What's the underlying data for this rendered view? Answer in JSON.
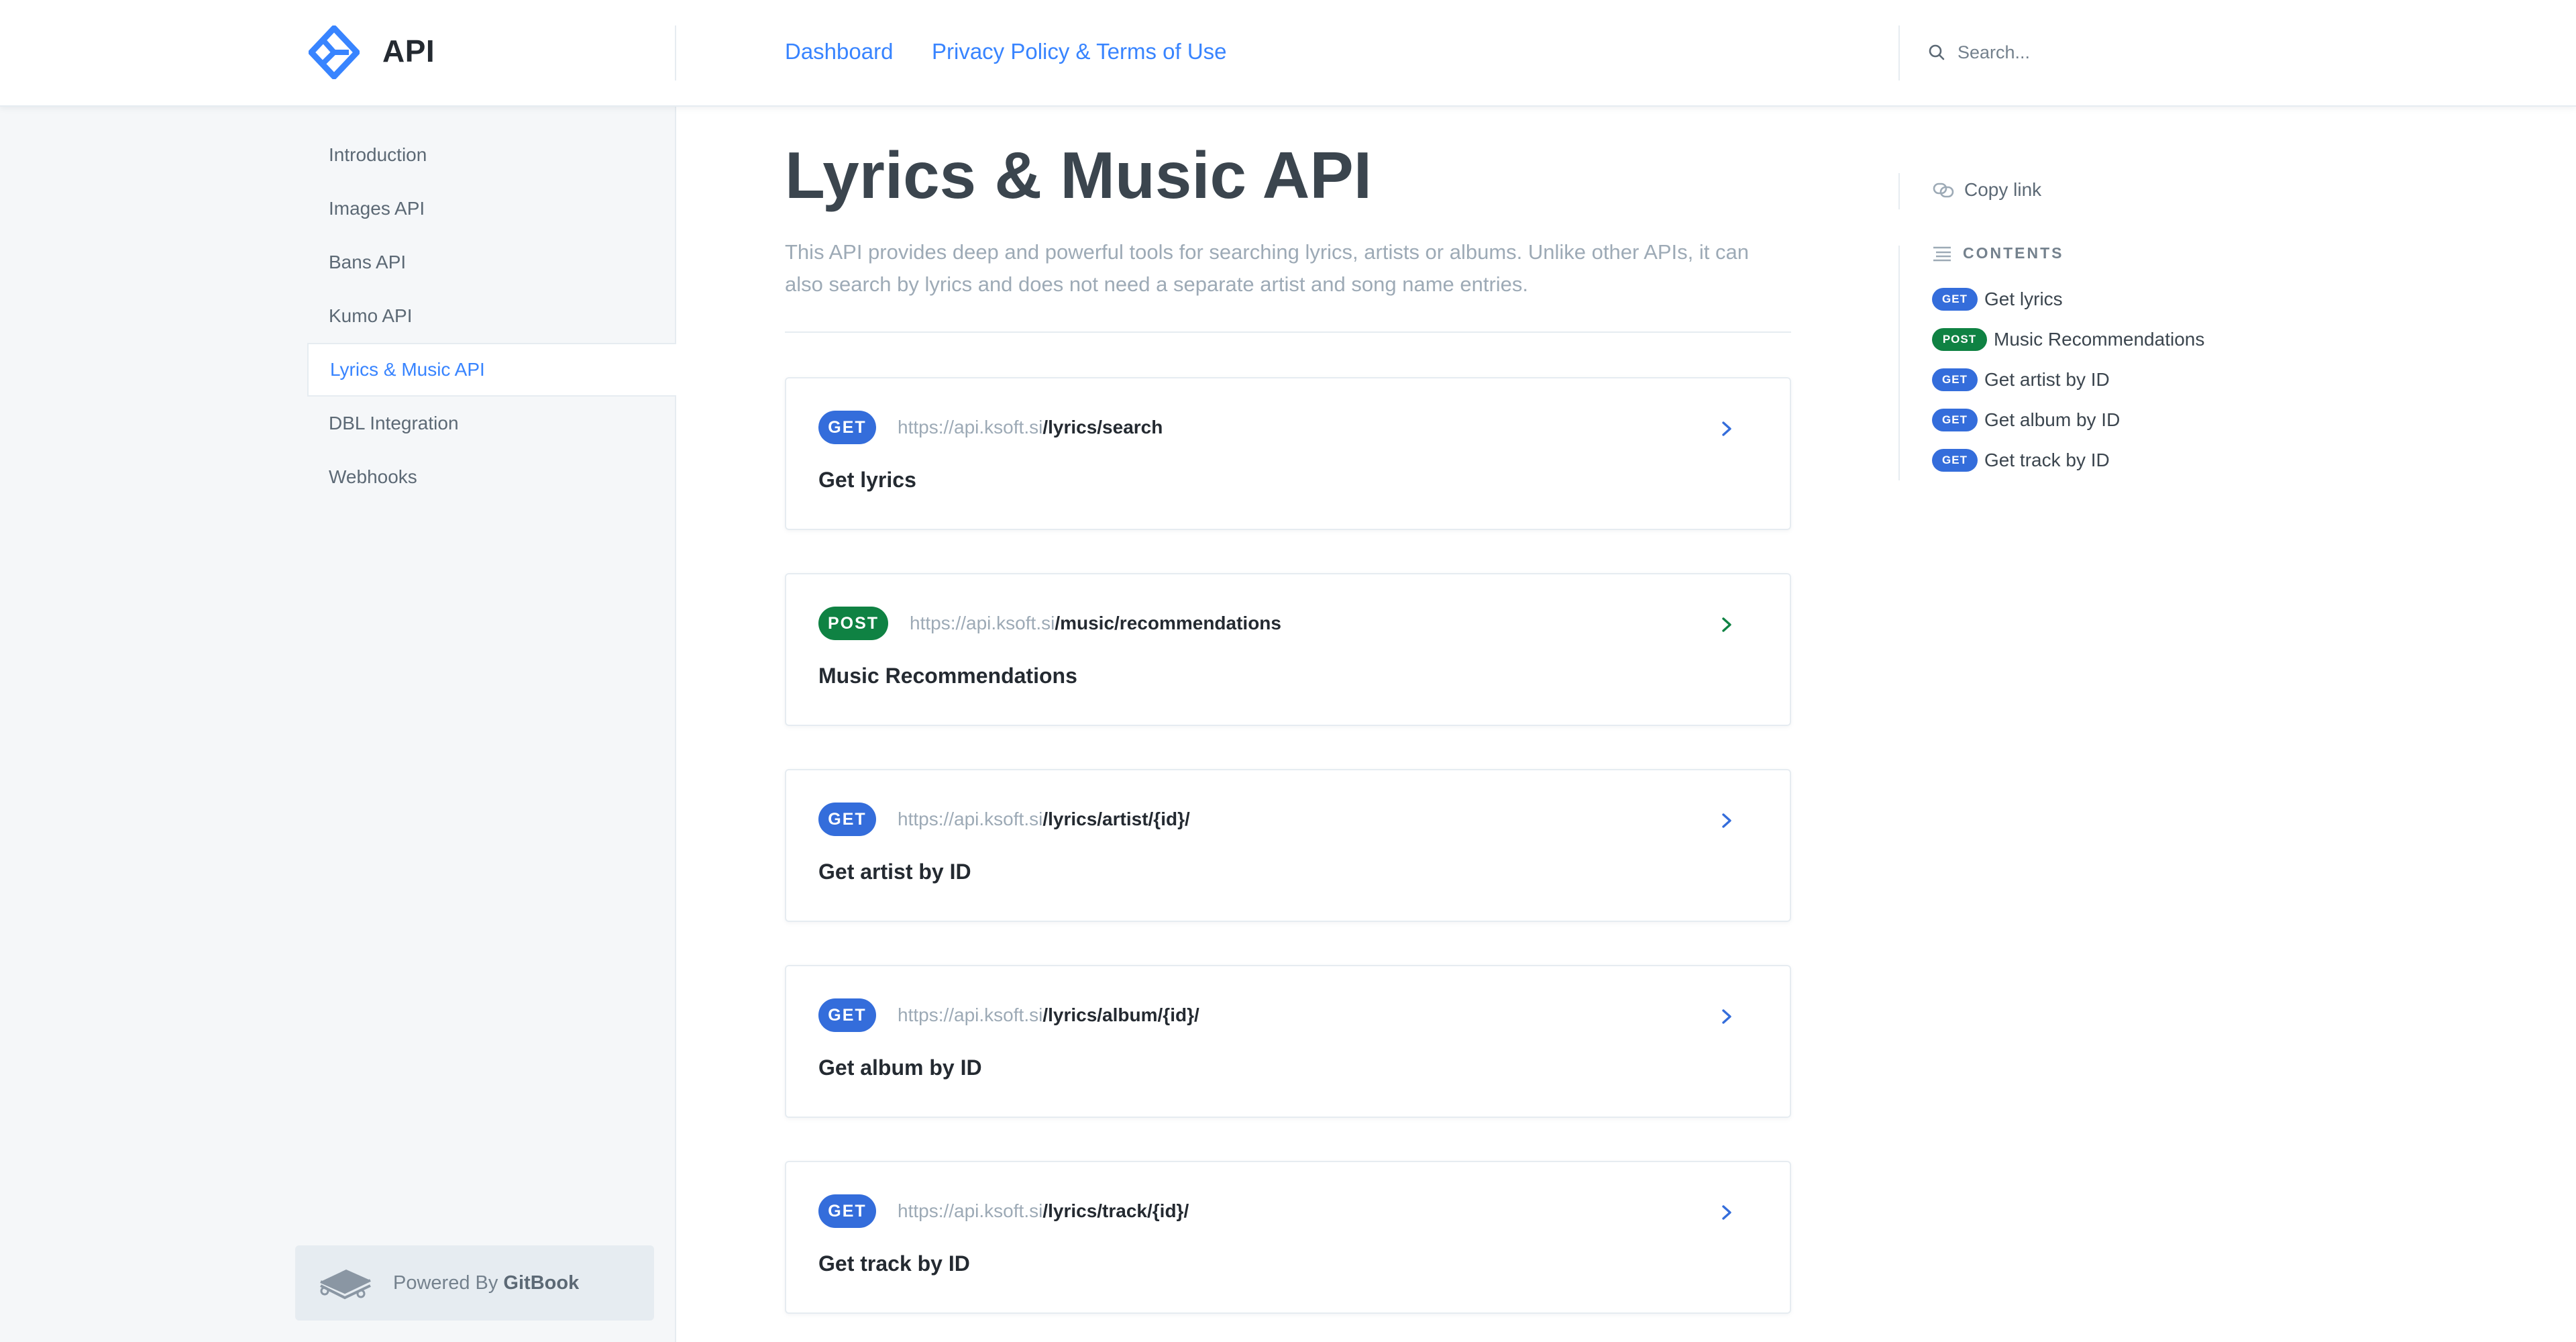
{
  "header": {
    "site_title": "API",
    "nav": [
      "Dashboard",
      "Privacy Policy & Terms of Use"
    ],
    "search_placeholder": "Search..."
  },
  "sidebar": {
    "items": [
      {
        "label": "Introduction",
        "active": false
      },
      {
        "label": "Images API",
        "active": false
      },
      {
        "label": "Bans API",
        "active": false
      },
      {
        "label": "Kumo API",
        "active": false
      },
      {
        "label": "Lyrics & Music API",
        "active": true
      },
      {
        "label": "DBL Integration",
        "active": false
      },
      {
        "label": "Webhooks",
        "active": false
      }
    ],
    "powered_prefix": "Powered By",
    "powered_brand": "GitBook"
  },
  "page": {
    "title": "Lyrics & Music API",
    "description": "This API provides deep and powerful tools for searching lyrics, artists or albums. Unlike other APIs, it can also search by lyrics and does not need a separate artist and song name entries."
  },
  "endpoints": [
    {
      "method": "GET",
      "base": "https://api.ksoft.si",
      "path": "/lyrics/search",
      "title": "Get lyrics"
    },
    {
      "method": "POST",
      "base": "https://api.ksoft.si",
      "path": "/music/recommendations",
      "title": "Music Recommendations"
    },
    {
      "method": "GET",
      "base": "https://api.ksoft.si",
      "path": "/lyrics/artist/{id}/",
      "title": "Get artist by ID"
    },
    {
      "method": "GET",
      "base": "https://api.ksoft.si",
      "path": "/lyrics/album/{id}/",
      "title": "Get album by ID"
    },
    {
      "method": "GET",
      "base": "https://api.ksoft.si",
      "path": "/lyrics/track/{id}/",
      "title": "Get track by ID"
    }
  ],
  "toc": {
    "copy_link": "Copy link",
    "contents_label": "CONTENTS",
    "items": [
      {
        "method": "GET",
        "label": "Get lyrics"
      },
      {
        "method": "POST",
        "label": "Music Recommendations"
      },
      {
        "method": "GET",
        "label": "Get artist by ID"
      },
      {
        "method": "GET",
        "label": "Get album by ID"
      },
      {
        "method": "GET",
        "label": "Get track by ID"
      }
    ]
  },
  "colors": {
    "accent": "#3884ff",
    "get_badge": "#346ddb",
    "post_badge": "#0f8243",
    "sidebar_bg": "#f5f7f9",
    "border": "#e6ecf1"
  },
  "icons": [
    "api-logo-icon",
    "search-icon",
    "chevron-right-icon",
    "link-icon",
    "list-icon",
    "gitbook-icon"
  ]
}
